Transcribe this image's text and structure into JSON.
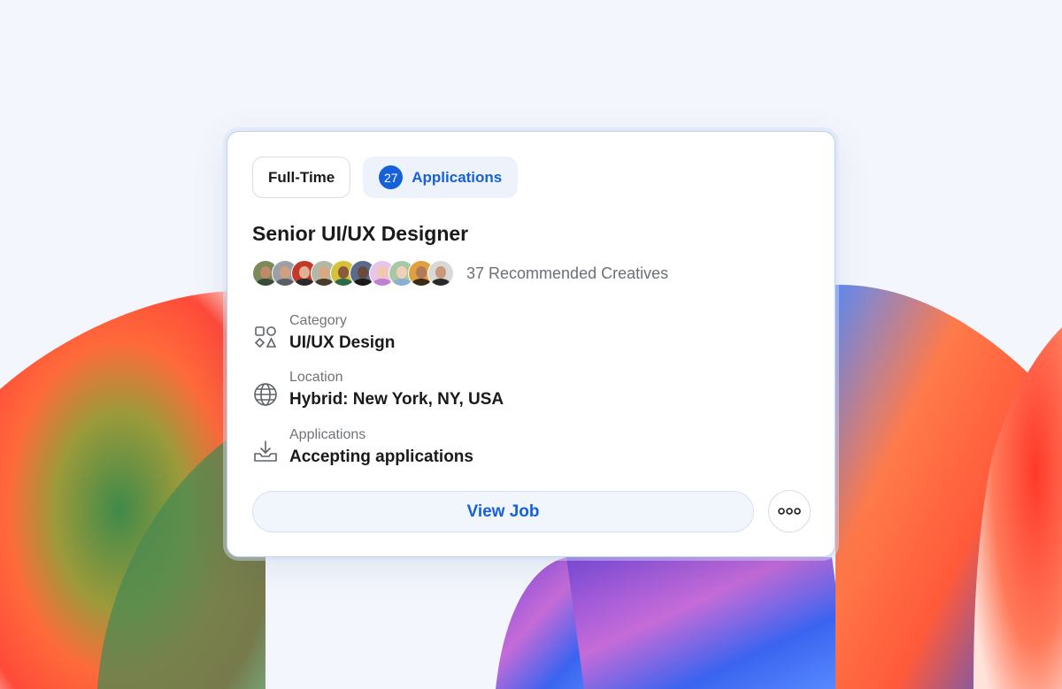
{
  "card": {
    "employment_type": "Full-Time",
    "applications_count": "27",
    "applications_label": "Applications",
    "job_title": "Senior UI/UX Designer",
    "recommended_text": "37 Recommended Creatives",
    "details": [
      {
        "label": "Category",
        "value": "UI/UX Design",
        "icon": "category-shapes-icon"
      },
      {
        "label": "Location",
        "value": "Hybrid: New York, NY, USA",
        "icon": "globe-icon"
      },
      {
        "label": "Applications",
        "value": "Accepting applications",
        "icon": "download-tray-icon"
      }
    ],
    "view_job_label": "View Job",
    "more_icon": "more-options-icon"
  },
  "colors": {
    "accent": "#1660d8",
    "badge_bg": "#eef3fb",
    "card_border": "#bcd0f0"
  }
}
